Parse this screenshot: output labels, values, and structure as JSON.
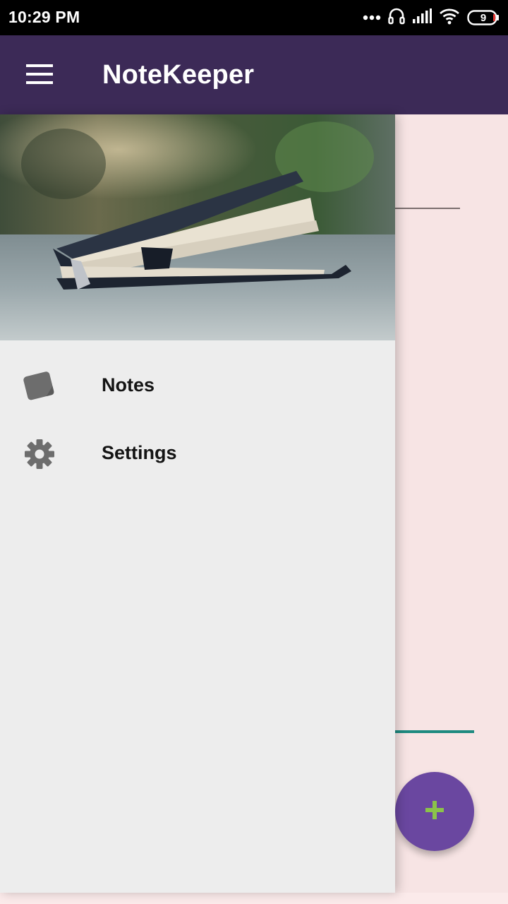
{
  "status_bar": {
    "time": "10:29 PM",
    "battery_level": "9"
  },
  "app_bar": {
    "title": "NoteKeeper",
    "menu_icon": "hamburger-menu-icon"
  },
  "drawer": {
    "header_image": "open-notebook-photo",
    "items": [
      {
        "label": "Notes",
        "icon": "note-icon"
      },
      {
        "label": "Settings",
        "icon": "gear-icon"
      }
    ]
  },
  "fab": {
    "icon": "plus-icon",
    "color": "#6a47a0",
    "icon_color": "#8bc34a"
  },
  "colors": {
    "app_bar": "#3c2a57",
    "drawer_background": "#ededed",
    "content_background": "#f7e4e4",
    "accent_line": "#1e8a80"
  }
}
